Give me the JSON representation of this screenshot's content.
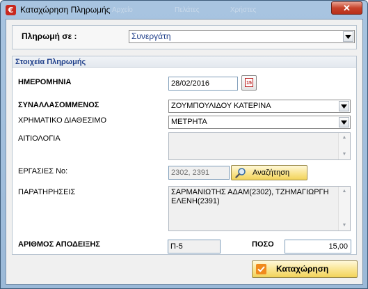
{
  "window": {
    "title": "Καταχώρηση Πληρωμής",
    "icon_glyph": "€",
    "close_glyph": "✕",
    "ghost_items": [
      "Αρχείο",
      "Πελάτες",
      "Χρήστες"
    ]
  },
  "payment_to": {
    "label": "Πληρωμή σε :",
    "value": "Συνεργάτη"
  },
  "details": {
    "header": "Στοιχεία Πληρωμής",
    "date_label": "ΗΜΕΡΟΜΗΝΙΑ",
    "date_value": "28/02/2016",
    "calendar_glyph": "15",
    "counterparty_label": "ΣΥΝΑΛΛΑΣΟΜΜΕΝΟΣ",
    "counterparty_value": "ΖΟΥΜΠΟΥΛΙΔΟΥ ΚΑΤΕΡΙΝΑ",
    "cash_label": "ΧΡΗΜΑΤΙΚΟ ΔΙΑΘΕΣΙΜΟ",
    "cash_value": "ΜΕΤΡΗΤΑ",
    "reason_label": "ΑΙΤΙΟΛΟΓΙΑ",
    "reason_value": "",
    "jobs_label": "ΕΡΓΑΣΙΕΣ Νο:",
    "jobs_value": "2302, 2391",
    "search_label": "Αναζήτηση",
    "notes_label": "ΠΑΡΑΤΗΡΗΣΕΙΣ",
    "notes_value": "ΣΑΡΜΑΝΙΩΤΗΣ ΑΔΑΜ(2302), ΤΖΗΜΑΓΙΩΡΓΗ ΕΛΕΝΗ(2391)"
  },
  "receipt": {
    "number_label": "ΑΡΙΘΜΟΣ ΑΠΟΔΕΙΞΗΣ",
    "number_value": "Π-5",
    "amount_label": "ΠΟΣΟ",
    "amount_value": "15,00"
  },
  "submit": {
    "label": "Καταχώρηση"
  },
  "colors": {
    "accent_header_text": "#1f3f8a",
    "button_gold": "#f2d35a",
    "close_red": "#c7432b"
  },
  "icons": {
    "title": "euro-app-icon",
    "calendar": "calendar-icon",
    "search": "magnifier-icon",
    "submit": "checkmark-icon",
    "dropdown": "chevron-down-icon"
  }
}
